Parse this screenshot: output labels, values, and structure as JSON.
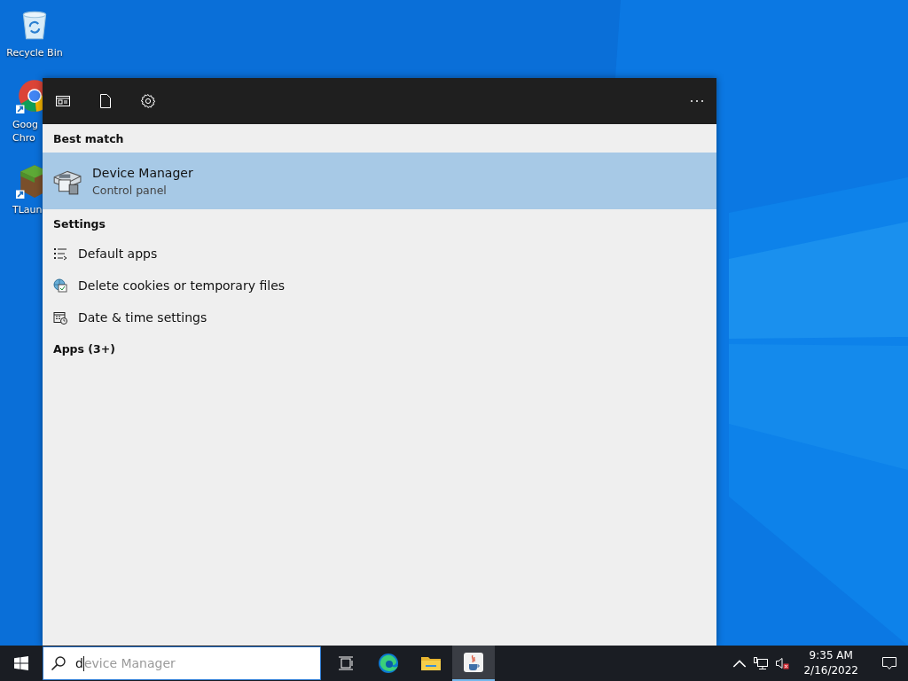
{
  "desktop": {
    "icons": [
      {
        "kind": "recycle-bin",
        "lines": [
          "Recycle Bin"
        ]
      },
      {
        "kind": "chrome",
        "lines": [
          "Goog",
          "Chro"
        ]
      },
      {
        "kind": "block",
        "lines": [
          "TLaun"
        ]
      }
    ]
  },
  "search_panel": {
    "sections": [
      {
        "kind": "best_match",
        "heading": "Best match",
        "items": [
          {
            "title": "Device Manager",
            "subtitle": "Control panel",
            "kind": "device",
            "selected": true
          }
        ]
      },
      {
        "kind": "list",
        "heading": "Settings",
        "items": [
          {
            "title": "Default apps",
            "kind": "list",
            "selected": false
          },
          {
            "title": "Delete cookies or temporary files",
            "kind": "cookies",
            "selected": false
          },
          {
            "title": "Date & time settings",
            "kind": "calendar",
            "selected": false
          }
        ]
      },
      {
        "kind": "collapsed",
        "heading": "Apps (3+)"
      }
    ]
  },
  "taskbar": {
    "search": {
      "value": "d",
      "suggestion": "evice Manager"
    },
    "apps": [
      {
        "kind": "task-view",
        "active": false
      },
      {
        "kind": "edge",
        "active": false
      },
      {
        "kind": "folder",
        "active": false
      },
      {
        "kind": "java",
        "active": true
      }
    ],
    "clock": {
      "time": "9:35 AM",
      "date": "2/16/2022"
    }
  }
}
